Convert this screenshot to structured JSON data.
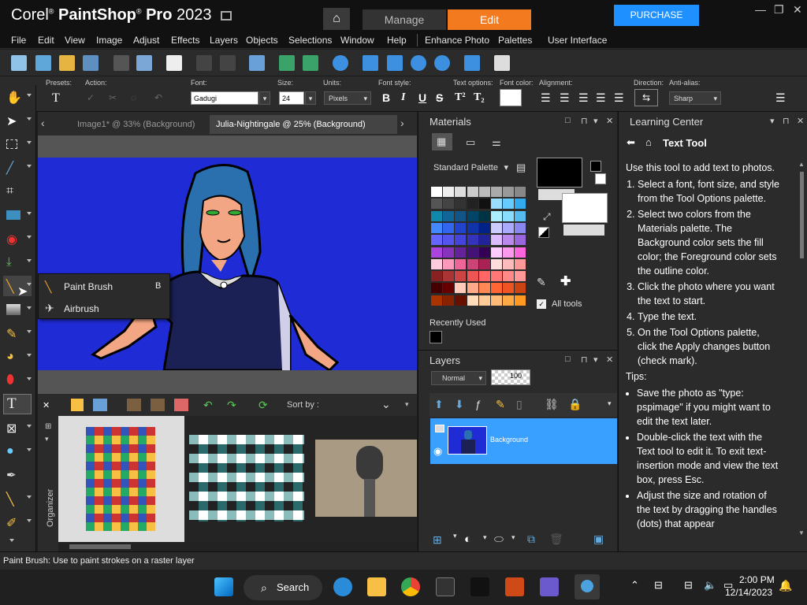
{
  "app": {
    "brand_prefix": "Corel",
    "brand_name": "PaintShop",
    "brand_pro": "Pro",
    "brand_year": "2023",
    "tabs": [
      "Manage",
      "Edit"
    ],
    "purchase_label": "PURCHASE",
    "accent": "#f47a1f",
    "purchase_color": "#1e90ff"
  },
  "menu": {
    "items": [
      "File",
      "Edit",
      "View",
      "Image",
      "Adjust",
      "Effects",
      "Layers",
      "Objects",
      "Selections",
      "Window",
      "Help",
      "Enhance Photo",
      "Palettes",
      "User Interface"
    ]
  },
  "tool_options": {
    "presets_label": "Presets:",
    "action_label": "Action:",
    "font_label": "Font:",
    "font_value": "Gadugi",
    "size_label": "Size:",
    "size_value": "24",
    "units_label": "Units:",
    "units_value": "Pixels",
    "font_style_label": "Font style:",
    "text_options_label": "Text options:",
    "font_color_label": "Font color:",
    "alignment_label": "Alignment:",
    "direction_label": "Direction:",
    "antialias_label": "Anti-alias:",
    "antialias_value": "Sharp",
    "style_buttons": [
      "B",
      "I",
      "U",
      "S",
      "T²",
      "T₂"
    ]
  },
  "document": {
    "tabs": [
      "Image1* @  33% (Background)",
      "Julia-Nightingale @  25% (Background)"
    ],
    "active_tab": 1
  },
  "flyout": {
    "items": [
      {
        "label": "Paint Brush",
        "shortcut": "B"
      },
      {
        "label": "Airbrush",
        "shortcut": ""
      }
    ]
  },
  "organizer": {
    "sort_label": "Sort by :",
    "side_label": "Organizer"
  },
  "materials": {
    "title": "Materials",
    "palette_select": "Standard Palette",
    "all_tools_label": "All tools",
    "recently_used_label": "Recently Used"
  },
  "layers": {
    "title": "Layers",
    "blend_mode": "Normal",
    "opacity": "100",
    "layer_name": "Background"
  },
  "learning_center": {
    "title": "Learning Center",
    "tool_title": "Text Tool",
    "intro": "Use this tool to add text to photos.",
    "steps": [
      "Select a font, font size, and style from the Tool Options palette.",
      "Select two colors from the Materials palette. The Background color sets the fill color; the Foreground color sets the outline color.",
      "Click the photo where you want the text to start.",
      "Type the text.",
      "On the Tool Options palette, click the Apply changes button (check mark)."
    ],
    "tips_label": "Tips:",
    "tips": [
      "Save the photo as \"type: pspimage\" if you might want to edit the text later.",
      "Double-click the text with the Text tool to edit it. To exit text-insertion mode and view the text box, press Esc.",
      "Adjust the size and rotation of the text by dragging the handles (dots) that appear"
    ]
  },
  "status": {
    "text": "Paint Brush: Use to paint strokes on a raster layer"
  },
  "taskbar": {
    "search_label": "Search",
    "time": "2:00 PM",
    "date": "12/14/2023"
  }
}
